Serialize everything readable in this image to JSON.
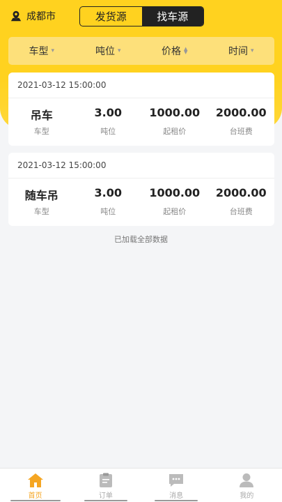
{
  "header": {
    "city": "成都市",
    "segments": [
      "发货源",
      "找车源"
    ],
    "active_segment": 1
  },
  "filters": [
    {
      "label": "车型",
      "icon": "caret-down-icon"
    },
    {
      "label": "吨位",
      "icon": "caret-down-icon"
    },
    {
      "label": "价格",
      "icon": "sort-icon"
    },
    {
      "label": "时间",
      "icon": "caret-down-icon"
    }
  ],
  "listings": [
    {
      "time": "2021-03-12 15:00:00",
      "fields": [
        {
          "value": "吊车",
          "label": "车型"
        },
        {
          "value": "3.00",
          "label": "吨位"
        },
        {
          "value": "1000.00",
          "label": "起租价"
        },
        {
          "value": "2000.00",
          "label": "台班费"
        }
      ]
    },
    {
      "time": "2021-03-12 15:00:00",
      "fields": [
        {
          "value": "随车吊",
          "label": "车型"
        },
        {
          "value": "3.00",
          "label": "吨位"
        },
        {
          "value": "1000.00",
          "label": "起租价"
        },
        {
          "value": "2000.00",
          "label": "台班费"
        }
      ]
    }
  ],
  "end_note": "已加载全部数据",
  "tabs": [
    {
      "label": "首页",
      "icon": "home-icon",
      "active": true
    },
    {
      "label": "订单",
      "icon": "clipboard-icon",
      "active": false
    },
    {
      "label": "消息",
      "icon": "chat-icon",
      "active": false
    },
    {
      "label": "我的",
      "icon": "user-icon",
      "active": false
    }
  ],
  "colors": {
    "accent": "#ffd21f",
    "tab_active": "#f5a623"
  }
}
